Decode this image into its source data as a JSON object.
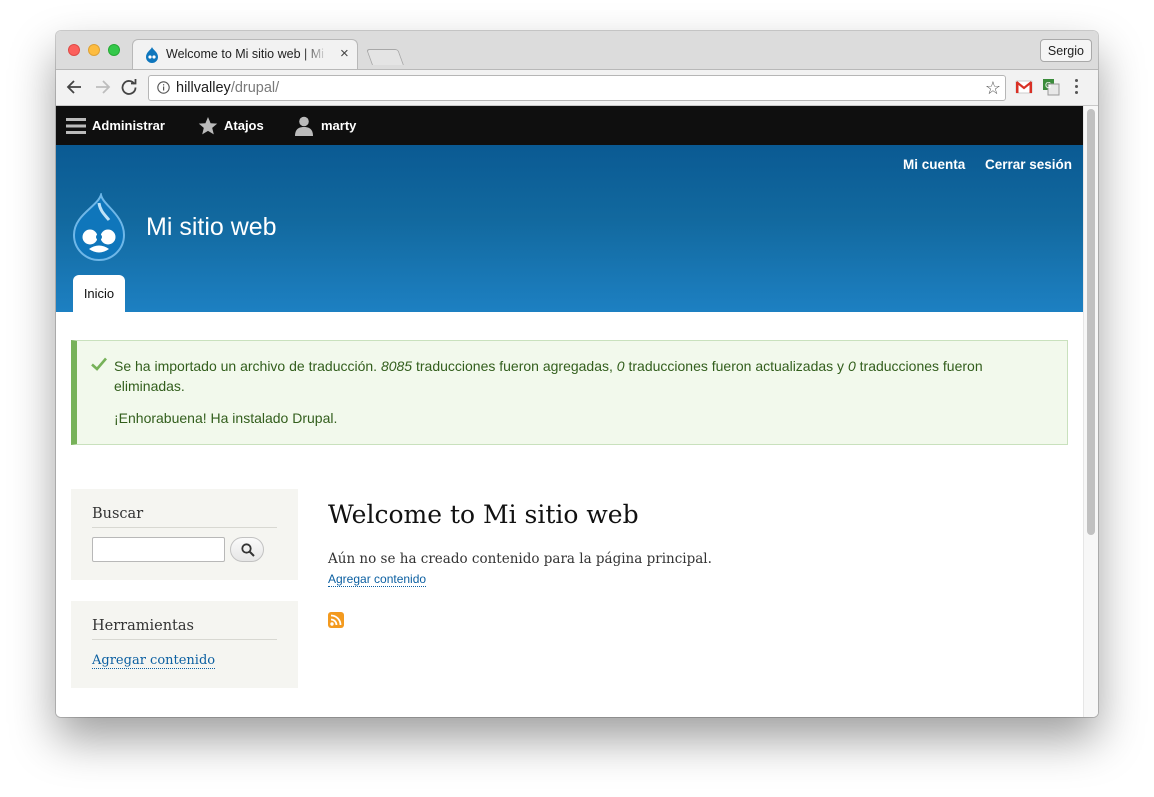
{
  "browser": {
    "tab_title": "Welcome to Mi sitio web | Mi sitio web",
    "tab_close": "×",
    "profile_name": "Sergio",
    "url_host": "hillvalley",
    "url_path": "/drupal/"
  },
  "admin_toolbar": {
    "manage_label": "Administrar",
    "shortcuts_label": "Atajos",
    "user_label": "marty"
  },
  "header": {
    "secondary_menu": [
      "Mi cuenta",
      "Cerrar sesión"
    ],
    "site_name": "Mi sitio web",
    "primary_tab": "Inicio"
  },
  "status_message": {
    "line1_a": "Se ha importado un archivo de traducción. ",
    "line1_n1": "8085",
    "line1_b": " traducciones fueron agregadas, ",
    "line1_n2": "0",
    "line1_c": " traducciones fueron actualizadas y ",
    "line1_n3": "0",
    "line1_d": " traducciones fueron eliminadas.",
    "line2": "¡Enhorabuena! Ha instalado Drupal."
  },
  "sidebar": {
    "search_title": "Buscar",
    "tools_title": "Herramientas",
    "tools_link": "Agregar contenido"
  },
  "main": {
    "title": "Welcome to Mi sitio web",
    "empty_text": "Aún no se ha creado contenido para la página principal.",
    "add_link": "Agregar contenido"
  },
  "colors": {
    "admin_bar": "#0f0f0f",
    "header_top": "#0a5a93",
    "header_bottom": "#1d80c2",
    "status_border": "#77b259",
    "link": "#0b5fa1"
  }
}
